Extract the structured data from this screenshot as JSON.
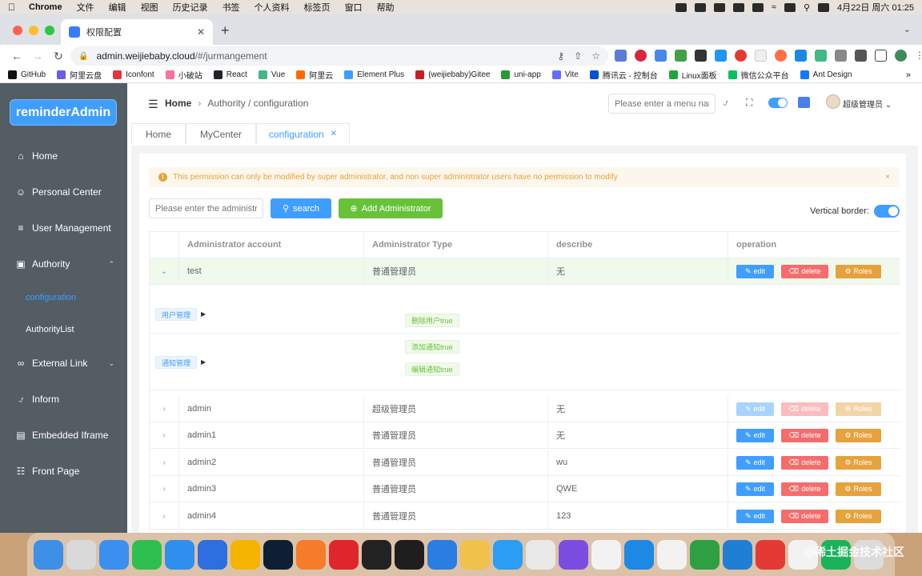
{
  "menubar": {
    "app": "Chrome",
    "items": [
      "文件",
      "编辑",
      "视图",
      "历史记录",
      "书签",
      "个人资料",
      "标签页",
      "窗口",
      "帮助"
    ],
    "clock": "4月22日 周六  01:25"
  },
  "browser": {
    "tab_title": "权限配置",
    "url_host": "admin.weijiebaby.cloud",
    "url_path": "/#/jurmangement",
    "bookmarks": [
      "GitHub",
      "阿里云盘",
      "Iconfont",
      "小破站",
      "React",
      "Vue",
      "阿里云",
      "Element Plus",
      "(weijiebaby)Gitee",
      "uni-app",
      "Vite",
      "腾讯云 - 控制台",
      "Linux面板",
      "微信公众平台",
      "Ant Design"
    ],
    "bookmark_colors": [
      "#111111",
      "#6b5ce7",
      "#e2363c",
      "#fa7299",
      "#20232a",
      "#42b883",
      "#ff6a00",
      "#409eff",
      "#c71d23",
      "#2b9939",
      "#646cff",
      "#0052d9",
      "#20a53a",
      "#07c160",
      "#1677ff"
    ]
  },
  "sidebar": {
    "logo": "reminderAdmin",
    "items": [
      {
        "label": "Home",
        "icon": "home-icon"
      },
      {
        "label": "Personal Center",
        "icon": "user-icon"
      },
      {
        "label": "User Management",
        "icon": "sliders-icon"
      },
      {
        "label": "Authority",
        "icon": "lock-icon"
      },
      {
        "label": "configuration",
        "icon": ""
      },
      {
        "label": "AuthorityList",
        "icon": ""
      },
      {
        "label": "External Link",
        "icon": "link-icon"
      },
      {
        "label": "Inform",
        "icon": "bell-icon"
      },
      {
        "label": "Embedded Iframe",
        "icon": "frame-icon"
      },
      {
        "label": "Front Page",
        "icon": "page-icon"
      }
    ]
  },
  "header": {
    "breadcrumb_home": "Home",
    "breadcrumb_rest": "Authority / configuration",
    "search_placeholder": "Please enter a menu name",
    "username": "超级管理员"
  },
  "tags": [
    {
      "label": "Home"
    },
    {
      "label": "MyCenter"
    },
    {
      "label": "configuration"
    }
  ],
  "alert": {
    "text": "This permission can only be modified by super administrator, and non super administrator users have no permission to modify",
    "close": "×"
  },
  "toolbar": {
    "input_placeholder": "Please enter the administrator",
    "search_label": "search",
    "add_label": "Add Administrator",
    "vertical_border_label": "Vertical border:"
  },
  "table": {
    "columns": [
      "Administrator account",
      "Administrator Type",
      "describe",
      "operation"
    ],
    "actions": {
      "edit": "edit",
      "delete": "delete",
      "roles": "Roles"
    },
    "rows": [
      {
        "account": "test",
        "type": "普通管理员",
        "describe": "无"
      },
      {
        "account": "admin",
        "type": "超级管理员",
        "describe": "无"
      },
      {
        "account": "admin1",
        "type": "普通管理员",
        "describe": "无"
      },
      {
        "account": "admin2",
        "type": "普通管理员",
        "describe": "wu"
      },
      {
        "account": "admin3",
        "type": "普通管理员",
        "describe": "QWE"
      },
      {
        "account": "admin4",
        "type": "普通管理员",
        "describe": "123"
      }
    ],
    "expanded": {
      "group1": {
        "label": "用户管理",
        "perms": [
          "删除用户true"
        ]
      },
      "group2": {
        "label": "通知管理",
        "perms": [
          "添加通知true",
          "编辑通知true"
        ]
      }
    }
  },
  "dock": {
    "apps": [
      {
        "icon": "finder-icon",
        "color": "#3d8fe8"
      },
      {
        "icon": "launchpad-icon",
        "color": "#d9d9d9"
      },
      {
        "icon": "mail-icon",
        "color": "#3a8ff0"
      },
      {
        "icon": "facetime-icon",
        "color": "#2fbf4f"
      },
      {
        "icon": "safari-icon",
        "color": "#2e8ff0"
      },
      {
        "icon": "app-icon",
        "color": "#2d6ee0"
      },
      {
        "icon": "app-icon",
        "color": "#f4b400"
      },
      {
        "icon": "photoshop-icon",
        "color": "#0d1f33"
      },
      {
        "icon": "app-icon",
        "color": "#f57c2b"
      },
      {
        "icon": "youdao-icon",
        "color": "#e0252c"
      },
      {
        "icon": "terminal-icon",
        "color": "#222222"
      },
      {
        "icon": "monitor-icon",
        "color": "#1e1e1e"
      },
      {
        "icon": "app-icon",
        "color": "#2a7de1"
      },
      {
        "icon": "app-icon",
        "color": "#f0c14b"
      },
      {
        "icon": "app-icon",
        "color": "#2a9df4"
      },
      {
        "icon": "wechat-icon",
        "color": "#e8e8e8"
      },
      {
        "icon": "app-icon",
        "color": "#7b4de0"
      },
      {
        "icon": "app-icon",
        "color": "#f2f2f2"
      },
      {
        "icon": "app-icon",
        "color": "#1e88e5"
      },
      {
        "icon": "chrome-icon",
        "color": "#f2f2f2"
      },
      {
        "icon": "hbuilder-icon",
        "color": "#2ea043"
      },
      {
        "icon": "vscode-icon",
        "color": "#1f7fd4"
      },
      {
        "icon": "wps-icon",
        "color": "#e53935"
      },
      {
        "icon": "qq-icon",
        "color": "#f2f2f2"
      },
      {
        "icon": "app-icon",
        "color": "#19b35b"
      },
      {
        "icon": "trash-icon",
        "color": "#dcdcdc"
      }
    ],
    "watermark": "@稀土掘金技术社区"
  }
}
